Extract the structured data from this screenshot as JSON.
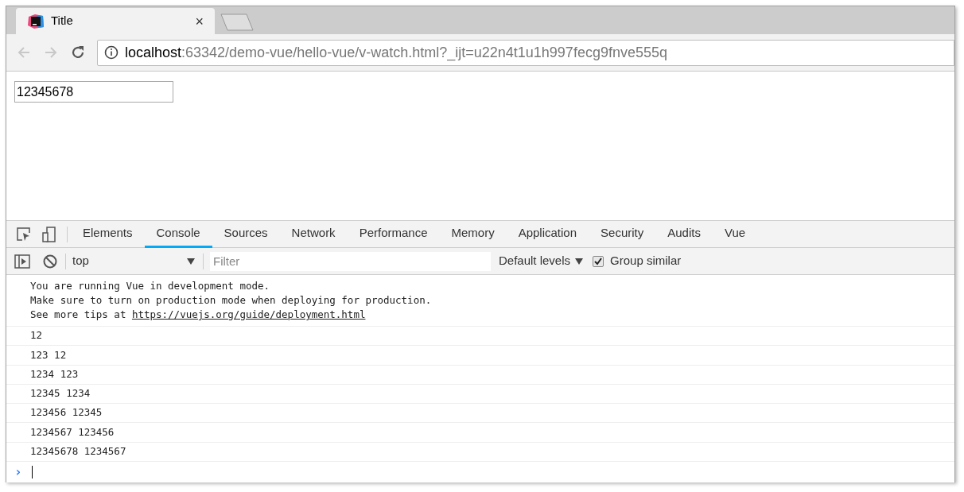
{
  "browser_tab": {
    "title": "Title",
    "close": "×",
    "selected": true
  },
  "address_bar": {
    "host": "localhost",
    "rest": ":63342/demo-vue/hello-vue/v-watch.html?_ijt=u22n4t1u1h997fecg9fnve555q"
  },
  "page": {
    "input_value": "12345678"
  },
  "devtools_tabs": [
    {
      "label": "Elements",
      "selected": false
    },
    {
      "label": "Console",
      "selected": true
    },
    {
      "label": "Sources",
      "selected": false
    },
    {
      "label": "Network",
      "selected": false
    },
    {
      "label": "Performance",
      "selected": false
    },
    {
      "label": "Memory",
      "selected": false
    },
    {
      "label": "Application",
      "selected": false
    },
    {
      "label": "Security",
      "selected": false
    },
    {
      "label": "Audits",
      "selected": false
    },
    {
      "label": "Vue",
      "selected": false
    }
  ],
  "console_toolbar": {
    "context": "top",
    "filter_placeholder": "Filter",
    "levels": "Default levels",
    "group_similar": {
      "label": "Group similar",
      "checked": true
    }
  },
  "vue_message": {
    "lines": [
      "You are running Vue in development mode.",
      "Make sure to turn on production mode when deploying for production."
    ],
    "tips_prefix": "See more tips at ",
    "link": "https://vuejs.org/guide/deployment.html"
  },
  "logs": [
    "12",
    "123 12",
    "1234 123",
    "12345 1234",
    "123456 12345",
    "1234567 123456",
    "12345678 1234567"
  ],
  "prompt": "›"
}
